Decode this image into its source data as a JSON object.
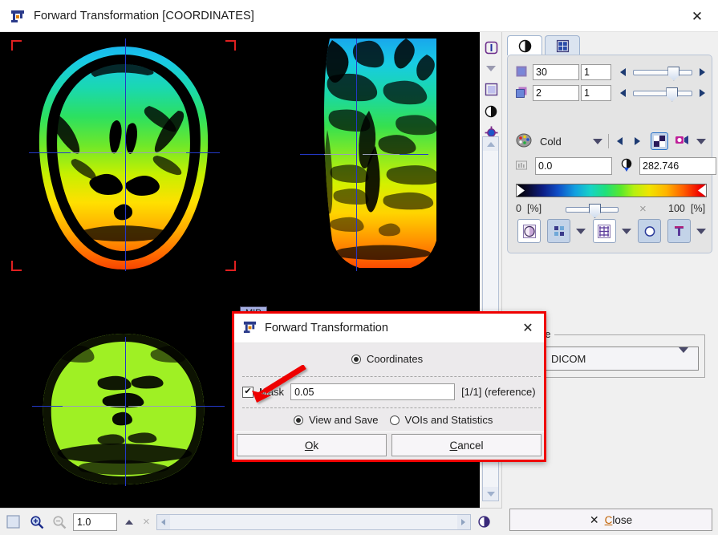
{
  "window": {
    "title": "Forward Transformation [COORDINATES]",
    "icon": "transform-icon",
    "close_label": "✕"
  },
  "viewer": {
    "mip_badge": "MIP",
    "slices": [
      {
        "name": "axial",
        "orientation": "Axial"
      },
      {
        "name": "sagittal-mip",
        "orientation": "Sagittal MIP"
      },
      {
        "name": "coronal",
        "orientation": "Coronal"
      }
    ]
  },
  "vstrip": {
    "buttons": [
      {
        "name": "info-icon",
        "label": "i"
      },
      {
        "name": "chevron-down-icon",
        "label": "▼"
      },
      {
        "name": "square-icon",
        "label": "■"
      },
      {
        "name": "contrast-icon",
        "label": "◐"
      },
      {
        "name": "crosshair-icon",
        "label": "⨁"
      }
    ]
  },
  "panel": {
    "tabs": [
      {
        "name": "tab-contrast",
        "icon": "contrast-icon",
        "active": true
      },
      {
        "name": "tab-layout",
        "icon": "layout-grid-icon",
        "active": false
      }
    ],
    "slice_row": {
      "icon": "slice-icon",
      "value": "30",
      "step": "1"
    },
    "frame_row": {
      "icon": "volume-icon",
      "value": "2",
      "step": "1"
    },
    "colormap": {
      "icon": "palette-icon",
      "name": "Cold",
      "caret": "▼"
    },
    "range": {
      "min_icon": "histogram-icon",
      "min": "0.0",
      "max_icon": "threshold-icon",
      "max": "282.746"
    },
    "scale": {
      "left_value": "0",
      "left_unit": "[%]",
      "right_value": "100",
      "right_unit": "[%]",
      "cancel_icon": "×"
    },
    "tools": [
      {
        "name": "contrast-tool-button",
        "icon": "contrast-icon",
        "selected": false
      },
      {
        "name": "overlay-tool-button",
        "icon": "overlay-icon",
        "selected": true
      },
      {
        "name": "grid-tool-button",
        "icon": "grid-icon",
        "selected": false
      },
      {
        "name": "shape-tool-button",
        "icon": "circle-icon",
        "selected": true
      },
      {
        "name": "annotate-tool-button",
        "icon": "text-annot-icon",
        "selected": true
      }
    ]
  },
  "save": {
    "legend": "Save",
    "format": "DICOM",
    "icon": "floppy-disk-icon",
    "caret": "▼"
  },
  "close_button": {
    "icon": "✕",
    "accel": "C",
    "rest": "lose"
  },
  "bottombar": {
    "select_icon": "selection-icon",
    "zoom_in_icon": "zoom-in-icon",
    "zoom_out_icon": "zoom-out-icon",
    "zoom_value": "1.0",
    "expand_icon": "▲",
    "clear_icon": "×",
    "toggle_icon": "contrast-toggle-icon"
  },
  "dialog": {
    "title": "Forward Transformation",
    "icon": "transform-icon",
    "close_label": "✕",
    "coordinates": {
      "label": "Coordinates",
      "selected": true
    },
    "mask": {
      "label": "Mask",
      "checked": true,
      "check_glyph": "✔",
      "value": "0.05",
      "reference": "[1/1] (reference)"
    },
    "mode": {
      "view_and_save": {
        "label": "View and Save",
        "selected": true
      },
      "vois_and_statistics": {
        "label": "VOIs and Statistics",
        "selected": false
      }
    },
    "buttons": {
      "ok": {
        "accel": "O",
        "rest": "k"
      },
      "cancel": {
        "accel": "C",
        "rest": "ancel"
      }
    }
  },
  "colors": {
    "accent_red": "#ef0000",
    "crosshair_blue": "#2438c8",
    "corner_marker_red": "#e02020",
    "panel_bg": "#e4e4e4",
    "canvas_bg": "#000000",
    "accel_orange": "#c06000"
  }
}
